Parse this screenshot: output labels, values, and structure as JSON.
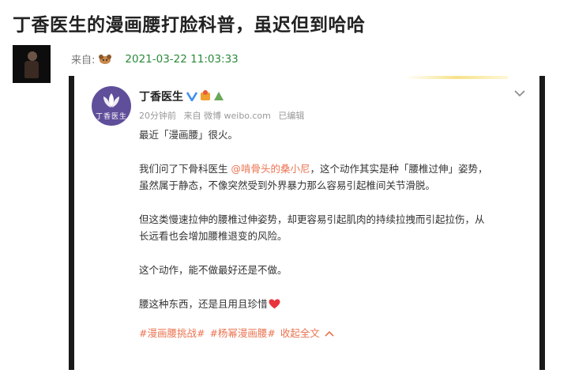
{
  "article": {
    "title": "丁香医生的漫画腰打脸科普，虽迟但到哈哈",
    "from_label": "来自:",
    "date": "2021-03-22 11:03:33"
  },
  "weibo": {
    "user_name": "丁香医生",
    "avatar_text": "丁香医生",
    "time_ago": "20分钟前",
    "source": "来自 微博 weibo.com",
    "edited": "已编辑",
    "paragraphs": {
      "p1": "最近「漫画腰」很火。",
      "p2_before": "我们问了下骨科医生 ",
      "p2_mention": "@啃骨头的桑小尼",
      "p2_after": "，这个动作其实是种「腰椎过伸」姿势，",
      "p2_line2": "虽然属于静态，不像突然受到外界暴力那么容易引起椎间关节滑脱。",
      "p3_line1": "但这类慢速拉伸的腰椎过伸姿势，却更容易引起肌肉的持续拉拽而引起拉伤，从",
      "p3_line2": "长远看也会增加腰椎退变的风险。",
      "p4": "这个动作，能不做最好还是不做。",
      "p5": "腰这种东西，还是且用且珍惜"
    },
    "tags": [
      "#漫画腰挑战#",
      "#杨幂漫画腰#"
    ],
    "collapse_label": "收起全文"
  },
  "colors": {
    "date": "#2a8a3a",
    "link": "#eb7350",
    "avatar": "#5f4e9a",
    "verified": "#3f8ff0"
  },
  "icons": [
    "from-icon",
    "verified-icon",
    "badge-icon",
    "chevron-down-icon",
    "heart-icon",
    "chevron-up-icon"
  ]
}
